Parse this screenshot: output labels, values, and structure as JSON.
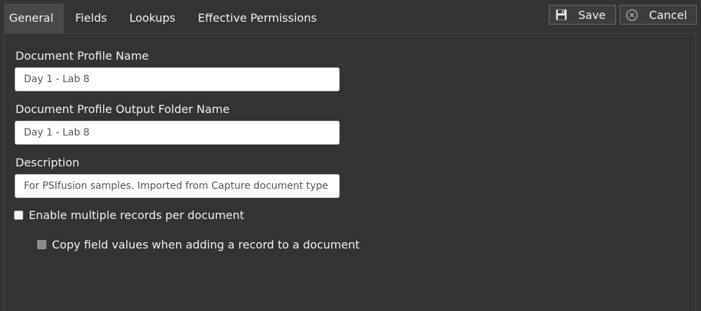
{
  "tabs": [
    {
      "label": "General",
      "active": true
    },
    {
      "label": "Fields",
      "active": false
    },
    {
      "label": "Lookups",
      "active": false
    },
    {
      "label": "Effective Permissions",
      "active": false
    }
  ],
  "toolbar": {
    "save_label": "Save",
    "save_icon": "floppy-disk-icon",
    "cancel_label": "Cancel",
    "cancel_icon": "circle-x-icon"
  },
  "form": {
    "profile_name_label": "Document Profile Name",
    "profile_name_value": "Day 1 - Lab 8",
    "output_folder_label": "Document Profile Output Folder Name",
    "output_folder_value": "Day 1 - Lab 8",
    "description_label": "Description",
    "description_value": "For PSIfusion samples. Imported from Capture document type Day",
    "multiple_records_label": "Enable multiple records per document",
    "multiple_records_checked": false,
    "copy_field_values_label": "Copy field values when adding a record to a document",
    "copy_field_values_checked": false,
    "copy_field_values_disabled": true
  },
  "colors": {
    "background": "#333333",
    "active_tab": "#484848",
    "text": "#f2f2f2",
    "input_bg": "#ffffff",
    "input_text": "#555555"
  }
}
